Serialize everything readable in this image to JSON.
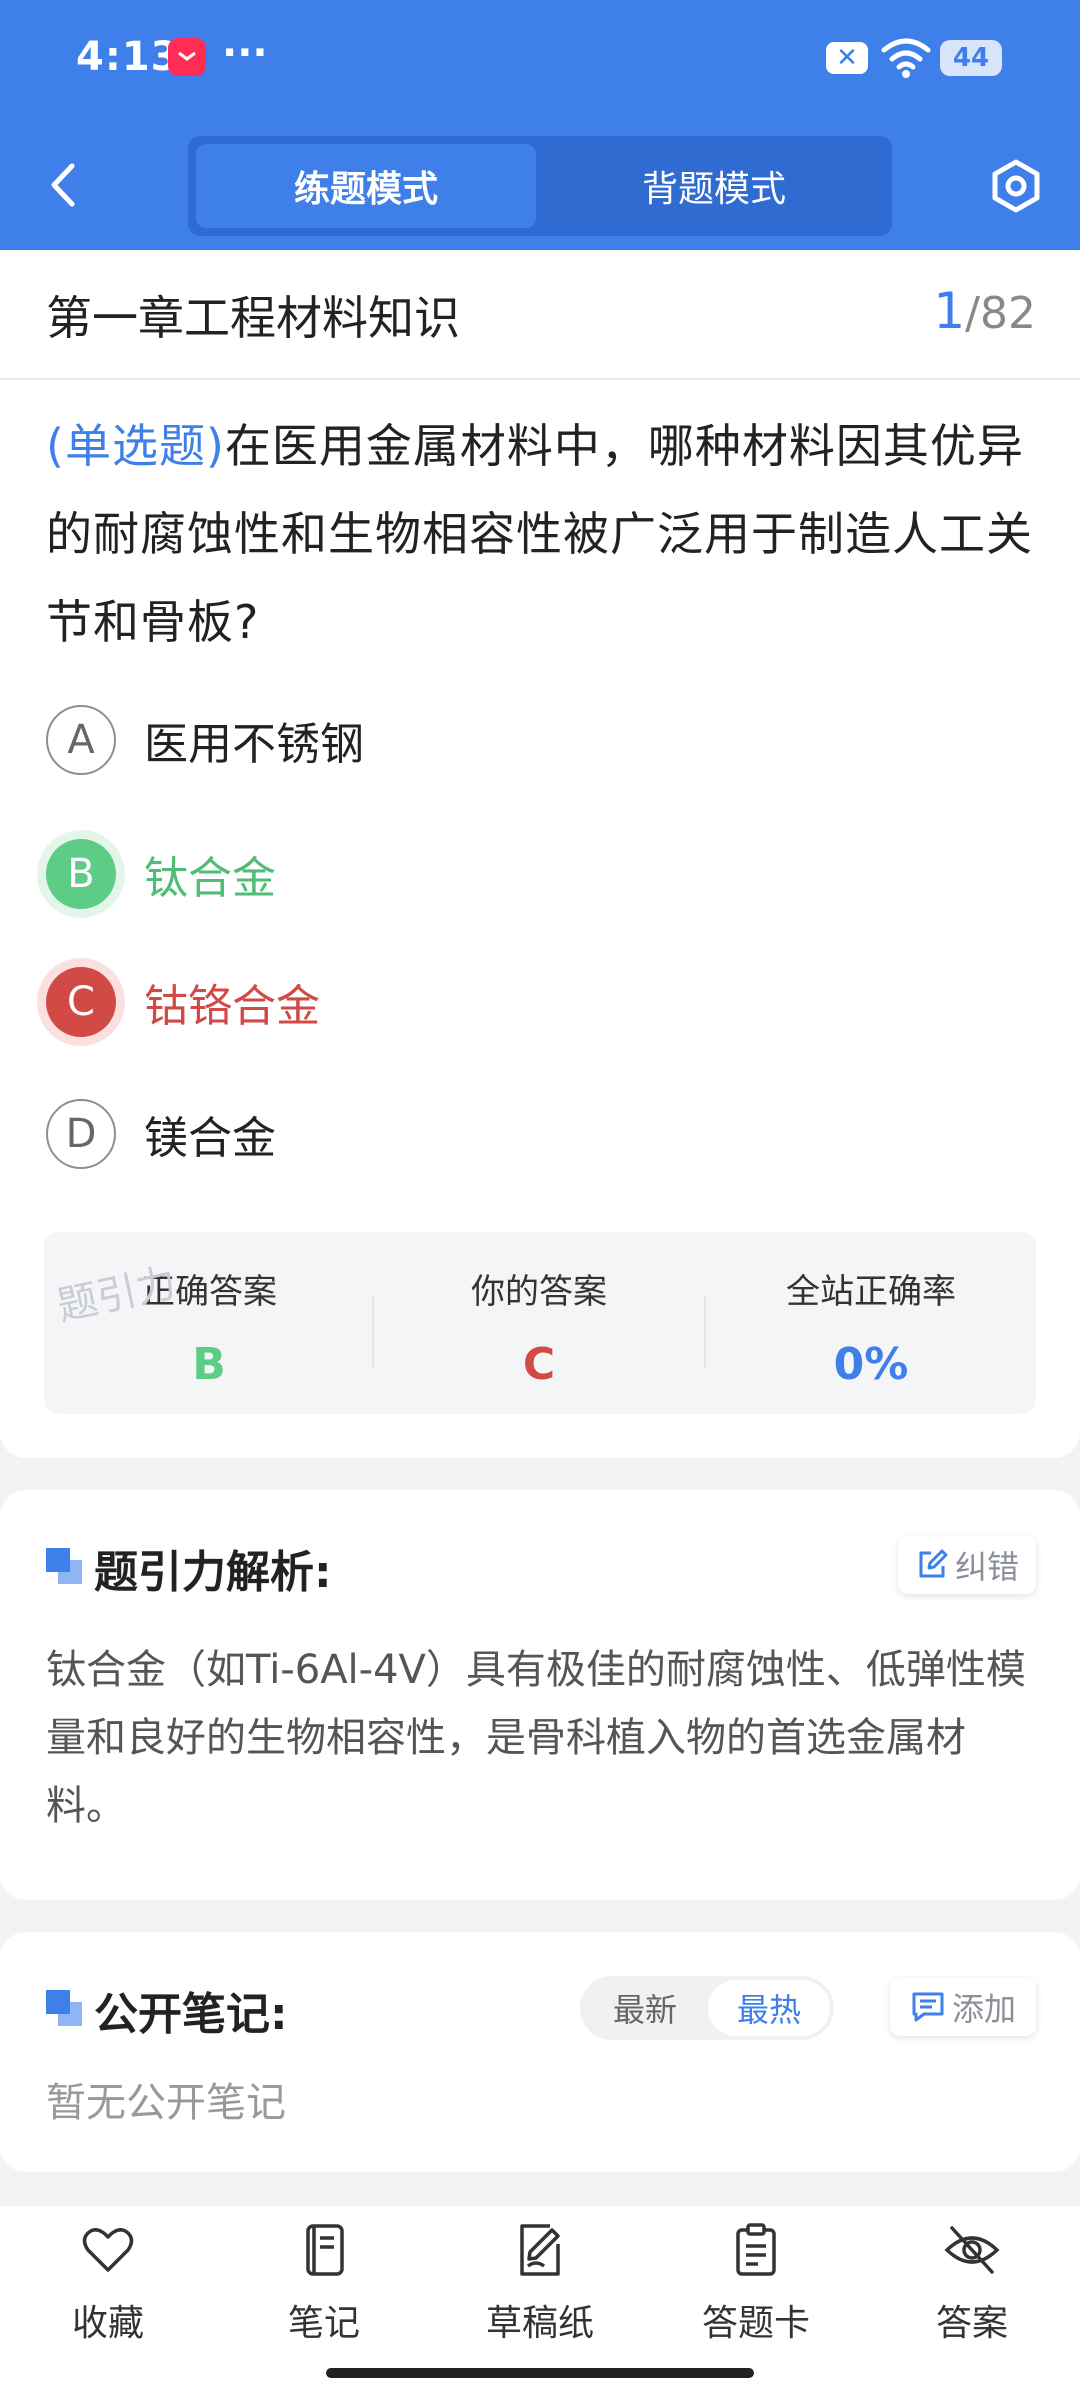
{
  "status_bar": {
    "time": "4:13",
    "more": "···",
    "battery": "44"
  },
  "header": {
    "modes": [
      "练题模式",
      "背题模式"
    ],
    "active_mode": "练题模式"
  },
  "question_header": {
    "chapter": "第一章工程材料知识",
    "current": "1",
    "separator": "/",
    "total": "82"
  },
  "question": {
    "type_label": "(单选题)",
    "text": "在医用金属材料中，哪种材料因其优异的耐腐蚀性和生物相容性被广泛用于制造人工关节和骨板?"
  },
  "options": [
    {
      "letter": "A",
      "text": "医用不锈钢",
      "state": "normal"
    },
    {
      "letter": "B",
      "text": "钛合金",
      "state": "correct"
    },
    {
      "letter": "C",
      "text": "钴铬合金",
      "state": "wrong"
    },
    {
      "letter": "D",
      "text": "镁合金",
      "state": "normal"
    }
  ],
  "answer_summary": {
    "watermark": "题引力",
    "correct_label": "正确答案",
    "correct_value": "B",
    "yours_label": "你的答案",
    "yours_value": "C",
    "rate_label": "全站正确率",
    "rate_value": "0%"
  },
  "analysis": {
    "title": "题引力解析:",
    "report_label": "纠错",
    "text": "钛合金（如Ti-6Al-4V）具有极佳的耐腐蚀性、低弹性模量和良好的生物相容性，是骨科植入物的首选金属材料。"
  },
  "notes": {
    "title": "公开笔记:",
    "sort_options": [
      "最新",
      "最热"
    ],
    "active_sort": "最热",
    "add_label": "添加",
    "empty_text": "暂无公开笔记"
  },
  "bottom_tabs": [
    "收藏",
    "笔记",
    "草稿纸",
    "答题卡",
    "答案"
  ],
  "colors": {
    "primary": "#3e7fe9",
    "correct": "#5dcd85",
    "wrong": "#d24a46"
  }
}
